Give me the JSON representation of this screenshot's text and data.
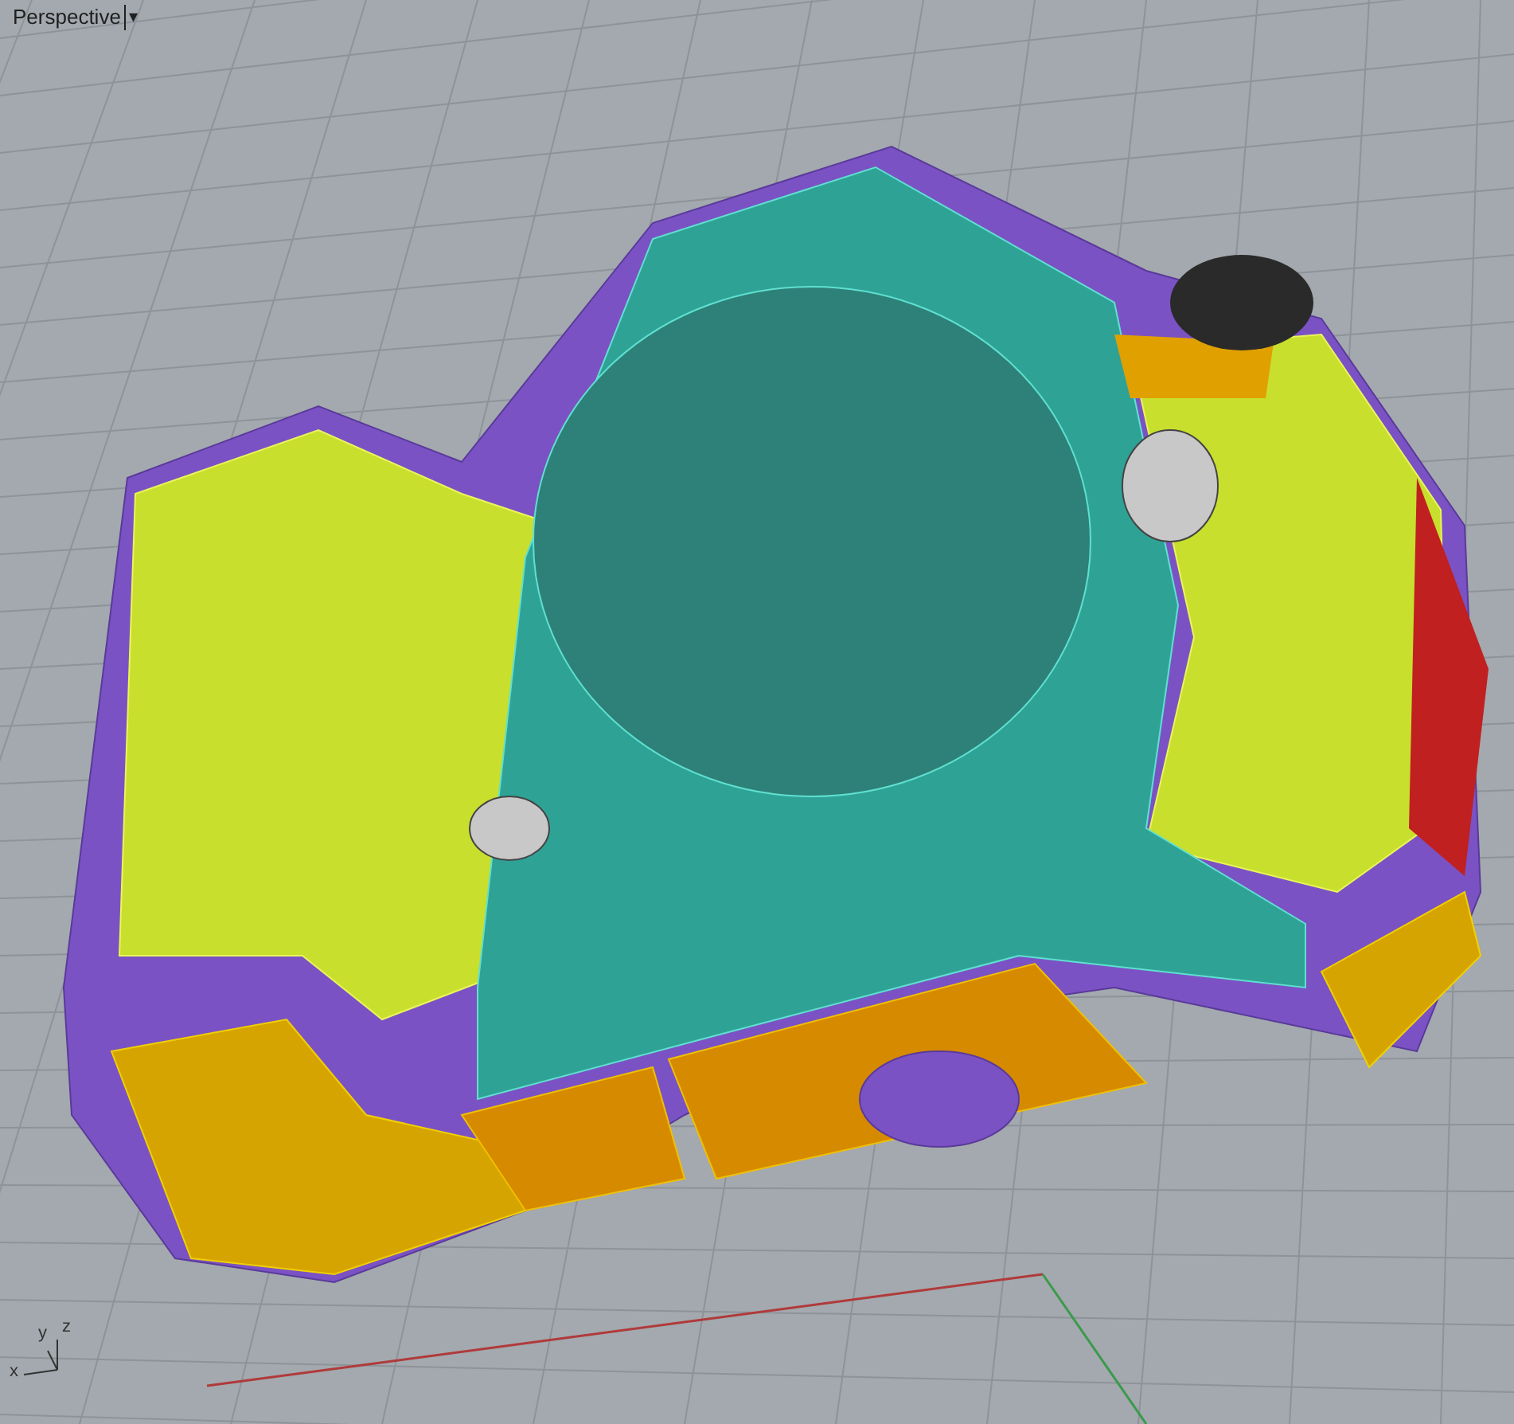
{
  "viewport": {
    "title": "Perspective",
    "menu_arrow": "▾"
  },
  "axes": {
    "x": "x",
    "y": "y",
    "z": "z"
  }
}
